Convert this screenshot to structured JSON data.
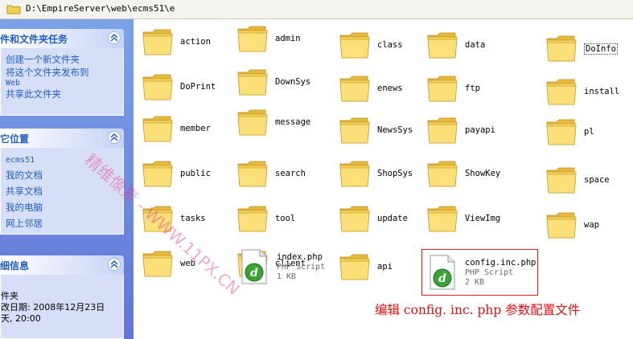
{
  "address": {
    "path": "D:\\EmpireServer\\web\\ecms51\\e"
  },
  "taskpane": {
    "file_tasks": {
      "title": "件和文件夹任务",
      "links": [
        "创建一个新文件夹",
        "将这个文件夹发布到",
        "Web",
        "共享此文件夹"
      ]
    },
    "other_places": {
      "title": "它位置",
      "links": [
        "ecms51",
        "我的文档",
        "共享文档",
        "我的电脑",
        "网上邻居"
      ]
    },
    "details": {
      "title": "细信息",
      "lines": [
        "件夹",
        "改日期: 2008年12月23日",
        "天, 20:00"
      ]
    }
  },
  "folders": [
    "action",
    "admin",
    "class",
    "data",
    "DoInfo",
    "DoPrint",
    "DownSys",
    "enews",
    "ftp",
    "install",
    "member",
    "message",
    "NewsSys",
    "payapi",
    "pl",
    "public",
    "search",
    "ShopSys",
    "ShowKey",
    "space",
    "tasks",
    "tool",
    "update",
    "ViewImg",
    "wap",
    "web",
    "client",
    "api"
  ],
  "files": [
    {
      "name": "index.php",
      "type": "PHP Script",
      "size": "1 KB"
    },
    {
      "name": "config.inc.php",
      "type": "PHP Script",
      "size": "2 KB"
    }
  ],
  "annotation": "编辑 config. inc. php 参数配置文件",
  "watermark": "精维像素 - WWW.11PX.CN",
  "colors": {
    "folder": "#f5cf4f",
    "link": "#215dc6",
    "annotation": "#e01010",
    "pane": "#6f8ee0"
  }
}
